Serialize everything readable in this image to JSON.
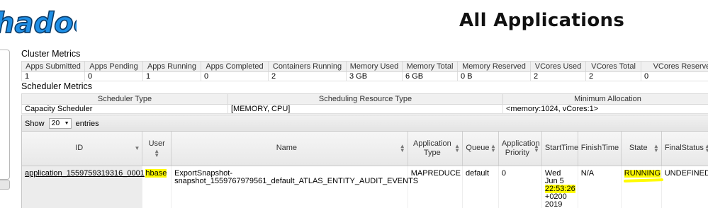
{
  "header": {
    "title": "All Applications",
    "logo_text": "hadoop"
  },
  "cluster_metrics": {
    "title": "Cluster Metrics",
    "headers": [
      "Apps Submitted",
      "Apps Pending",
      "Apps Running",
      "Apps Completed",
      "Containers Running",
      "Memory Used",
      "Memory Total",
      "Memory Reserved",
      "VCores Used",
      "VCores Total",
      "VCores Reserved"
    ],
    "values": [
      "1",
      "0",
      "1",
      "0",
      "2",
      "3 GB",
      "6 GB",
      "0 B",
      "2",
      "2",
      "0"
    ]
  },
  "scheduler_metrics": {
    "title": "Scheduler Metrics",
    "headers": [
      "Scheduler Type",
      "Scheduling Resource Type",
      "Minimum Allocation"
    ],
    "values": [
      "Capacity Scheduler",
      "[MEMORY, CPU]",
      "<memory:1024, vCores:1>"
    ]
  },
  "apps": {
    "show_label": "Show",
    "page_size": "20",
    "entries_label": "entries",
    "columns": {
      "id": "ID",
      "user": "User",
      "name": "Name",
      "app_type": "Application Type",
      "queue": "Queue",
      "priority": "Application Priority",
      "start_time": "StartTime",
      "finish_time": "FinishTime",
      "state": "State",
      "final_status": "FinalStatus"
    },
    "row": {
      "id": "application_1559759319316_0001",
      "user": "hbase",
      "name": "ExportSnapshot-snapshot_1559767979561_default_ATLAS_ENTITY_AUDIT_EVENTS",
      "app_type": "MAPREDUCE",
      "queue": "default",
      "priority": "0",
      "start_day": "Wed Jun 5",
      "start_clock": "22:53:26",
      "start_tz": "+0200 2019",
      "finish_time": "N/A",
      "state": "RUNNING",
      "final_status": "UNDEFINED"
    }
  },
  "colors": {
    "highlight": "#fffb00",
    "logo_blue": "#1f8fe6"
  }
}
